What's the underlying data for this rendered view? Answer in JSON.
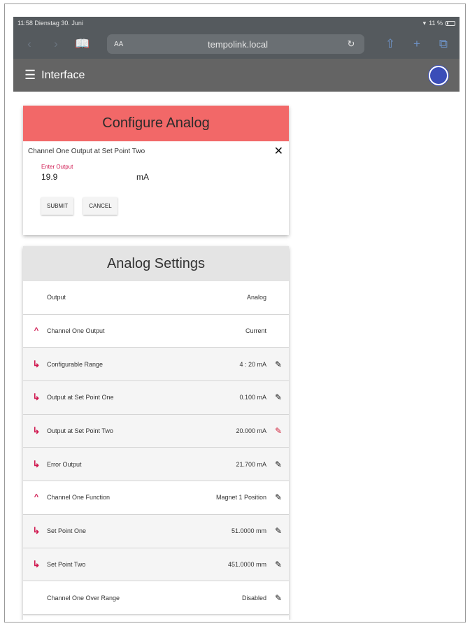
{
  "status_bar": {
    "time_date": "11:58  Dienstag 30. Juni",
    "battery": "11 %"
  },
  "browser": {
    "text_size": "AA",
    "host": "tempolink.local"
  },
  "appbar": {
    "title": "Interface",
    "avatar_color": "#3b4db8"
  },
  "dialog": {
    "title": "Configure Analog",
    "subtitle": "Channel One Output at Set Point Two",
    "input_label": "Enter Output",
    "input_value": "19.9",
    "unit": "mA",
    "submit_label": "SUBMIT",
    "cancel_label": "CANCEL",
    "header_color": "#f26868"
  },
  "settings": {
    "title": "Analog Settings",
    "header": {
      "label": "Output",
      "value": "Analog"
    },
    "rows": [
      {
        "label": "Channel One Output",
        "value": "Current",
        "lead": "caret-up-icon",
        "editable": false
      },
      {
        "label": "Configurable Range",
        "value": "4 : 20 mA",
        "lead": "sub-arrow-icon",
        "editable": true
      },
      {
        "label": "Output at Set Point One",
        "value": "0.100 mA",
        "lead": "sub-arrow-icon",
        "editable": true
      },
      {
        "label": "Output at Set Point Two",
        "value": "20.000 mA",
        "lead": "sub-arrow-icon",
        "editable": true,
        "active": true
      },
      {
        "label": "Error Output",
        "value": "21.700 mA",
        "lead": "sub-arrow-icon",
        "editable": true
      },
      {
        "label": "Channel One Function",
        "value": "Magnet 1 Position",
        "lead": "caret-up-icon",
        "editable": true
      },
      {
        "label": "Set Point One",
        "value": "51.0000 mm",
        "lead": "sub-arrow-icon",
        "editable": true
      },
      {
        "label": "Set Point Two",
        "value": "451.0000 mm",
        "lead": "sub-arrow-icon",
        "editable": true
      },
      {
        "label": "Channel One Over Range",
        "value": "Disabled",
        "lead": "none",
        "editable": true
      }
    ]
  }
}
